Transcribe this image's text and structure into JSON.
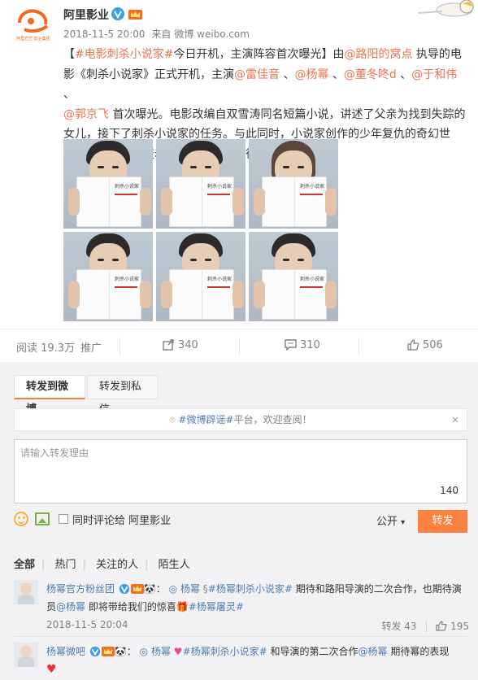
{
  "post": {
    "author": "阿里影业",
    "time": "2018-11-5 20:00",
    "source_prefix": "来自",
    "source": "微博 weibo.com",
    "logo_text": "阿里巴巴 影业集团",
    "text": {
      "p1": "【",
      "tag1": "#电影刺杀小说家#",
      "p2": "今日开机，主演阵容首次曝光】由",
      "at1": "@路阳的窝点",
      "p3": " 执导的电影《刺杀小说家》正式开机，主演",
      "at2": "@雷佳音",
      "p4": " 、",
      "at3": "@杨幂",
      "p5": " 、",
      "at4": "@董冬咚d",
      "p6": " 、",
      "at5": "@于和伟",
      "p7": " 、",
      "at6": "@郭京飞",
      "p8": " 首次曝光。电影改编自双雪涛同名短篇小说，讲述了父亲为找到失踪的女儿，接下了刺杀小说家的任务。与此同时，小说家创作的少年复仇的奇幻世界，也正悄悄改变着现实世界。很期待了！"
    },
    "book_title": "刺杀小说家"
  },
  "stats": {
    "read": "阅读 19.3万",
    "promote": "推广",
    "repost": "340",
    "comment": "310",
    "like": "506"
  },
  "repost_panel": {
    "tab1": "转发到微博",
    "tab2": "转发到私信",
    "notice_tag": "#微博辟谣#",
    "notice_rest": "平台，欢迎查阅！",
    "close": "×",
    "placeholder": "请输入转发理由",
    "counter": "140",
    "also_comment": "同时评论给 阿里影业",
    "visibility": "公开",
    "submit": "转发"
  },
  "filters": [
    "全部",
    "热门",
    "关注的人",
    "陌生人"
  ],
  "comments": [
    {
      "user": "杨幂官方粉丝团",
      "sep": "：",
      "at": "杨幂",
      "tag": "#杨幂刺杀小说家#",
      "text": " 期待和路阳导演的二次合作，也期待演员",
      "at2": "@杨幂",
      "text2": " 即将带给我们的惊喜",
      "tag2": "#杨幂屠灵#",
      "time": "2018-11-5 20:04",
      "repost": "转发 43",
      "likes": "195"
    },
    {
      "user": "杨幂微吧",
      "sep": "：",
      "at": "杨幂",
      "tag": "#杨幂刺杀小说家#",
      "text": " 和导演的第二次合作",
      "at2": "@杨幂",
      "text2": " 期待幂的表现"
    }
  ],
  "colors": {
    "accent": "#eb7350",
    "link": "#507daf",
    "button": "#ff8140"
  }
}
